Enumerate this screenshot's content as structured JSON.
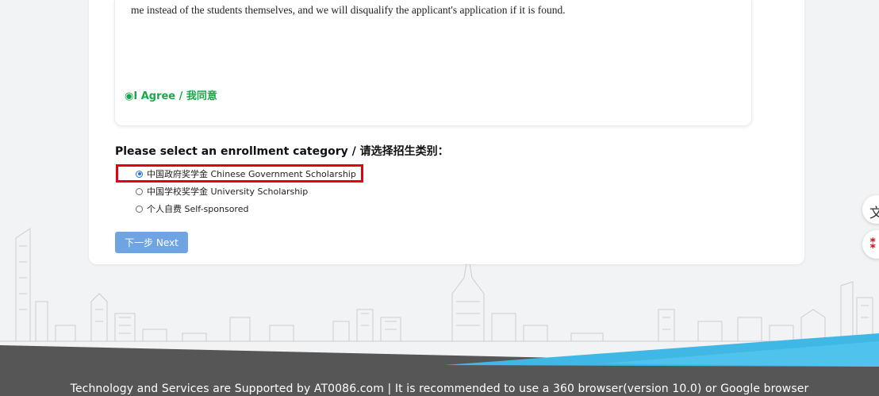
{
  "agreement": {
    "text": "me instead of the students themselves, and we will disqualify the applicant's application if it is found.",
    "agree_label": "◉I Agree / 我同意"
  },
  "enrollment": {
    "title": "Please select an enrollment category / 请选择招生类别：",
    "options": [
      {
        "label": "中国政府奖学金 Chinese Government Scholarship",
        "selected": true
      },
      {
        "label": "中国学校奖学金 University Scholarship",
        "selected": false
      },
      {
        "label": "个人自费 Self-sponsored",
        "selected": false
      }
    ]
  },
  "buttons": {
    "next_label": "下一步 Next"
  },
  "side": {
    "translate_glyph": "文",
    "share_glyph": "⁑"
  },
  "footer": {
    "text": "Technology and Services are Supported by AT0086.com | It is recommended to use a 360 browser(version 10.0) or Google browser"
  },
  "colors": {
    "accent": "#1a73e8",
    "agree_green": "#18a84a",
    "highlight_red": "#e3000f",
    "button_blue": "#6fa4e3",
    "footer_gray": "#565656",
    "footer_cyan": "#3fb8e6"
  }
}
